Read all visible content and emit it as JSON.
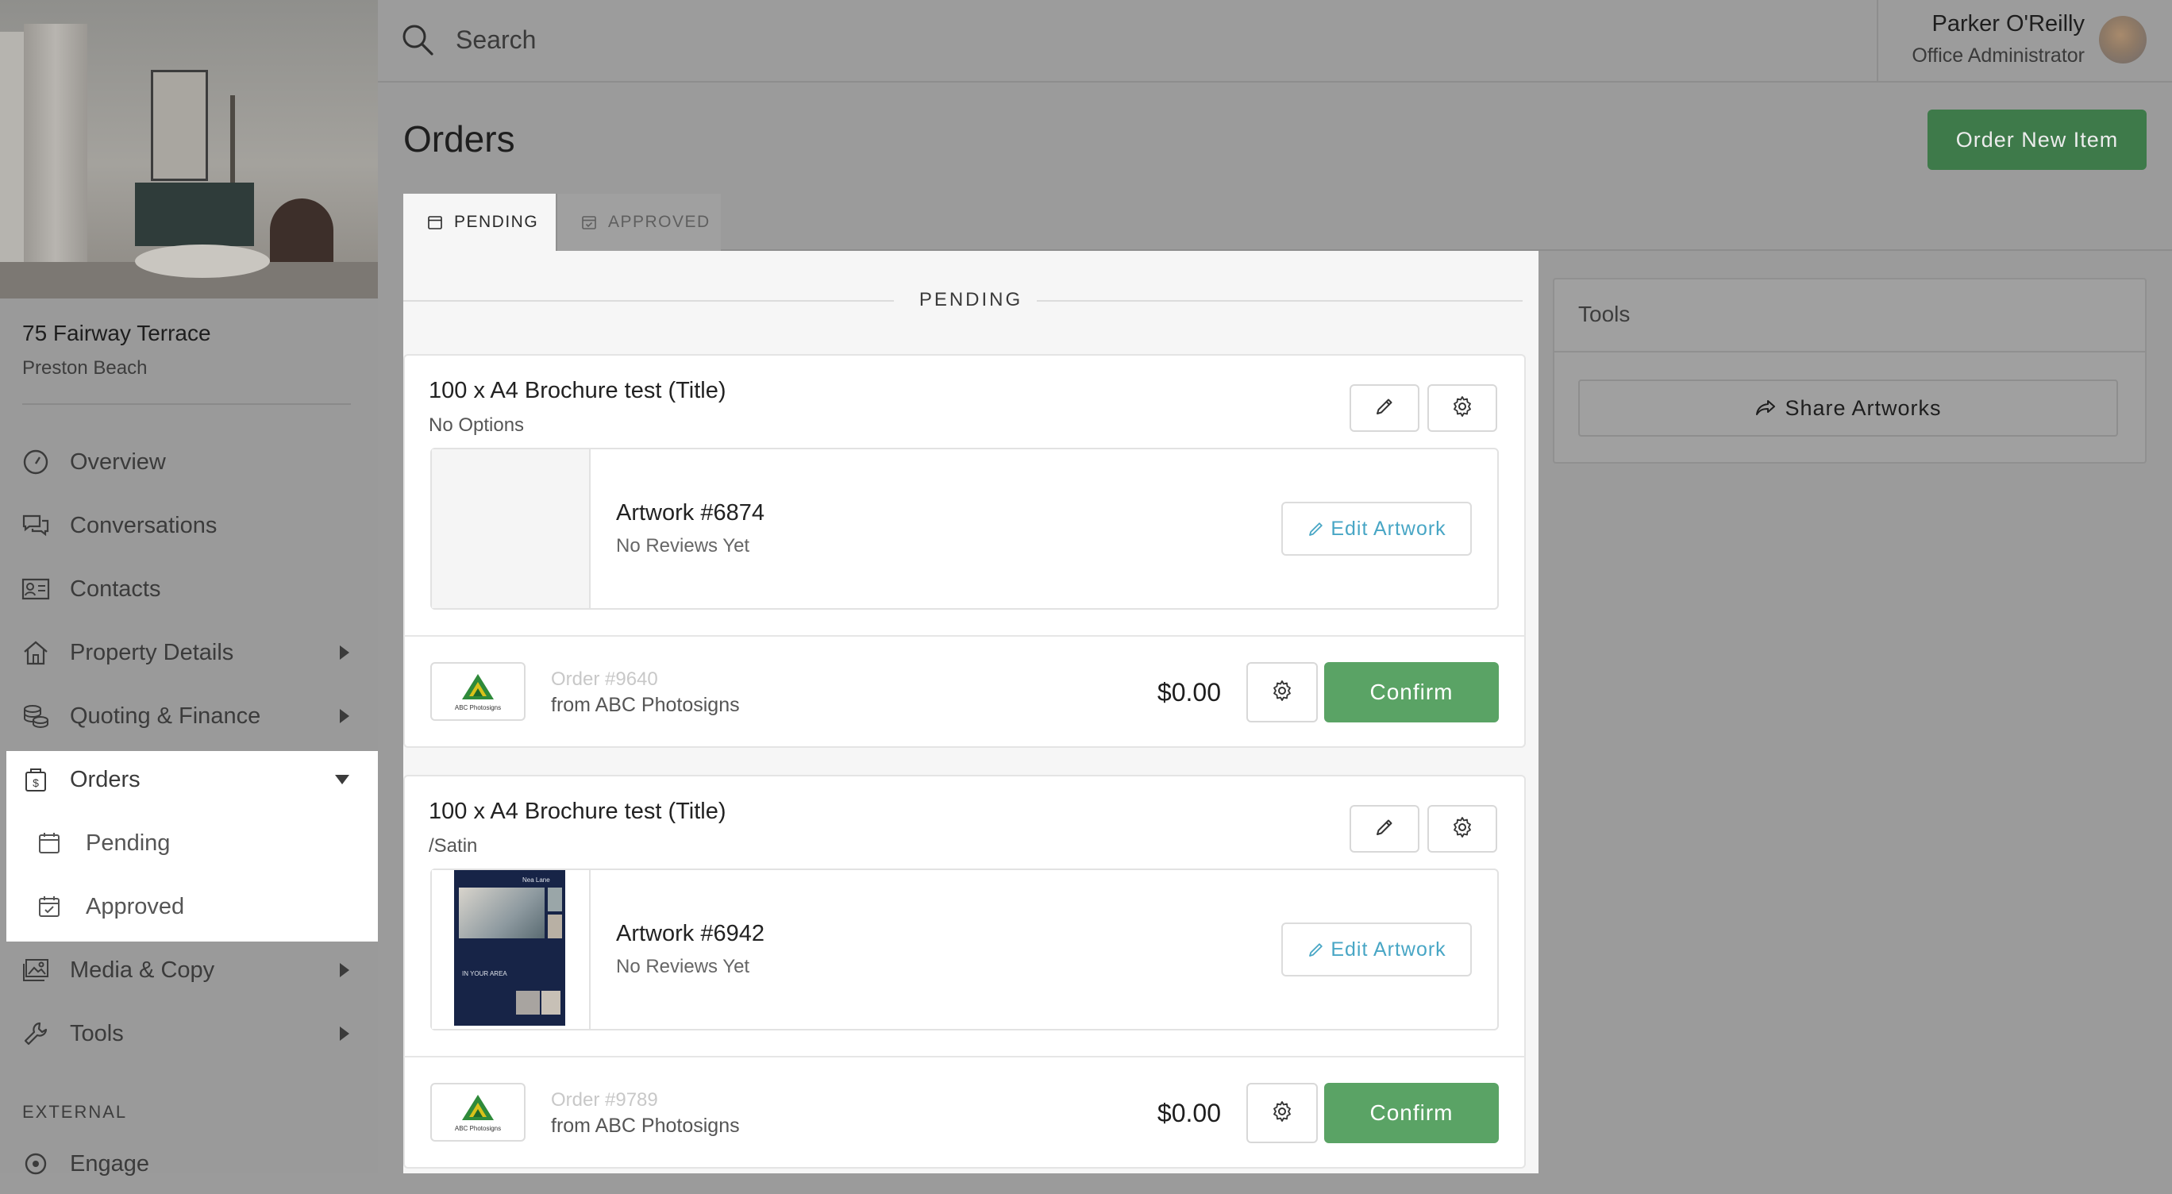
{
  "property": {
    "address": "75 Fairway Terrace",
    "suburb": "Preston Beach"
  },
  "nav": {
    "overview": "Overview",
    "conversations": "Conversations",
    "contacts": "Contacts",
    "property_details": "Property Details",
    "quoting_finance": "Quoting & Finance",
    "orders": "Orders",
    "pending": "Pending",
    "approved": "Approved",
    "media_copy": "Media & Copy",
    "tools": "Tools",
    "external_label": "EXTERNAL",
    "engage": "Engage"
  },
  "search": {
    "placeholder": "Search"
  },
  "user": {
    "name": "Parker O'Reilly",
    "role": "Office Administrator"
  },
  "page": {
    "title": "Orders",
    "order_new_label": "Order New Item"
  },
  "tabs": {
    "pending": "PENDING",
    "approved": "APPROVED"
  },
  "panel": {
    "header": "PENDING"
  },
  "orders": [
    {
      "title": "100 x A4 Brochure test (Title)",
      "options": "No Options",
      "artwork": "Artwork #6874",
      "reviews": "No Reviews Yet",
      "edit_label": "Edit Artwork",
      "order_no": "Order #9640",
      "supplier": "from ABC Photosigns",
      "price": "$0.00",
      "confirm_label": "Confirm"
    },
    {
      "title": "100 x A4 Brochure test (Title)",
      "options": "/Satin",
      "artwork": "Artwork #6942",
      "reviews": "No Reviews Yet",
      "edit_label": "Edit Artwork",
      "order_no": "Order #9789",
      "supplier": "from ABC Photosigns",
      "price": "$0.00",
      "confirm_label": "Confirm"
    }
  ],
  "brochure": {
    "header": "Nea Lane",
    "area_text": "IN YOUR AREA"
  },
  "supplier_logo_text": "ABC Photosigns",
  "tools_panel": {
    "title": "Tools",
    "share_label": "Share Artworks"
  },
  "colors": {
    "primary_green": "#3e7a4a",
    "confirm_green": "#5aa365",
    "link_blue": "#48a6c5"
  }
}
